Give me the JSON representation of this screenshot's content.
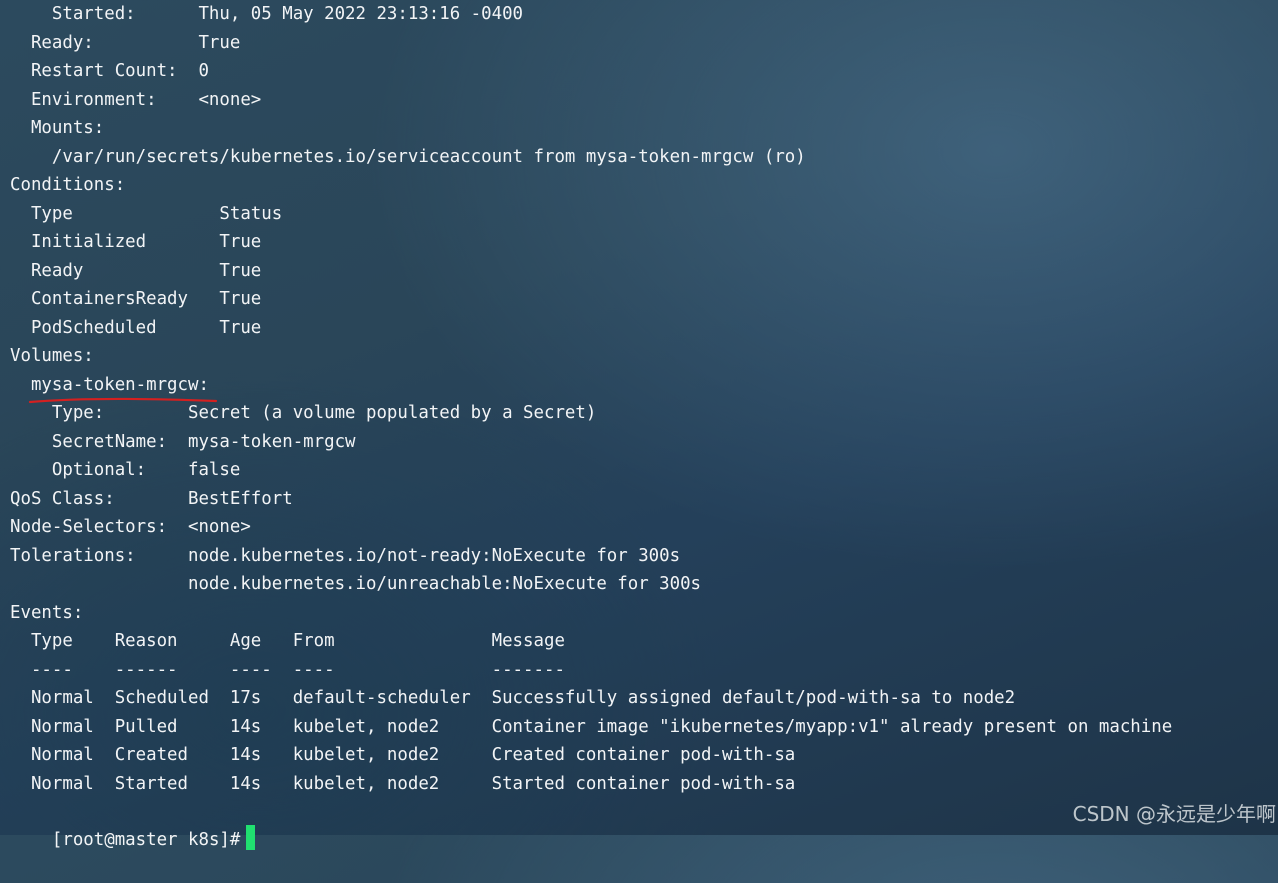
{
  "terminal": {
    "lines": [
      "    Started:      Thu, 05 May 2022 23:13:16 -0400",
      "  Ready:          True",
      "  Restart Count:  0",
      "  Environment:    <none>",
      "  Mounts:",
      "    /var/run/secrets/kubernetes.io/serviceaccount from mysa-token-mrgcw (ro)",
      "Conditions:",
      "  Type              Status",
      "  Initialized       True",
      "  Ready             True",
      "  ContainersReady   True",
      "  PodScheduled      True",
      "Volumes:",
      "  mysa-token-mrgcw:",
      "    Type:        Secret (a volume populated by a Secret)",
      "    SecretName:  mysa-token-mrgcw",
      "    Optional:    false",
      "QoS Class:       BestEffort",
      "Node-Selectors:  <none>",
      "Tolerations:     node.kubernetes.io/not-ready:NoExecute for 300s",
      "                 node.kubernetes.io/unreachable:NoExecute for 300s",
      "Events:",
      "  Type    Reason     Age   From               Message",
      "  ----    ------     ----  ----               -------",
      "  Normal  Scheduled  17s   default-scheduler  Successfully assigned default/pod-with-sa to node2",
      "  Normal  Pulled     14s   kubelet, node2     Container image \"ikubernetes/myapp:v1\" already present on machine",
      "  Normal  Created    14s   kubelet, node2     Created container pod-with-sa",
      "  Normal  Started    14s   kubelet, node2     Started container pod-with-sa"
    ],
    "prompt": "[root@master k8s]#",
    "cursor_color": "#20e070",
    "annotation_color": "#d42020"
  },
  "watermark": "CSDN @永远是少年啊"
}
